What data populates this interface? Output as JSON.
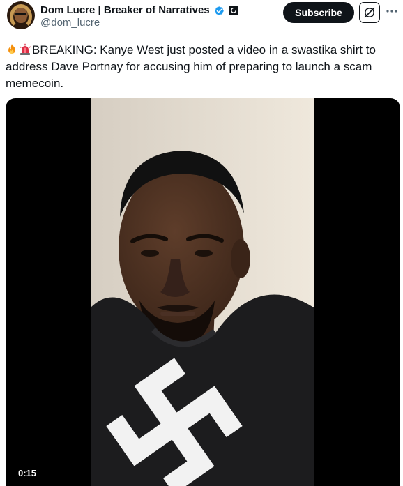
{
  "author": {
    "display_name": "Dom Lucre | Breaker of Narratives",
    "handle": "@dom_lucre",
    "verified_color": "#1d9bf0"
  },
  "actions": {
    "subscribe_label": "Subscribe",
    "grok_icon": "grok-icon",
    "more_icon": "more-icon"
  },
  "post": {
    "emojis": [
      "fire-emoji",
      "siren-emoji"
    ],
    "text": "BREAKING: Kanye West just posted a video in a swastika shirt to address Dave Portnay for accusing him of preparing to launch a scam memecoin."
  },
  "media": {
    "type": "video",
    "duration": "0:15"
  }
}
